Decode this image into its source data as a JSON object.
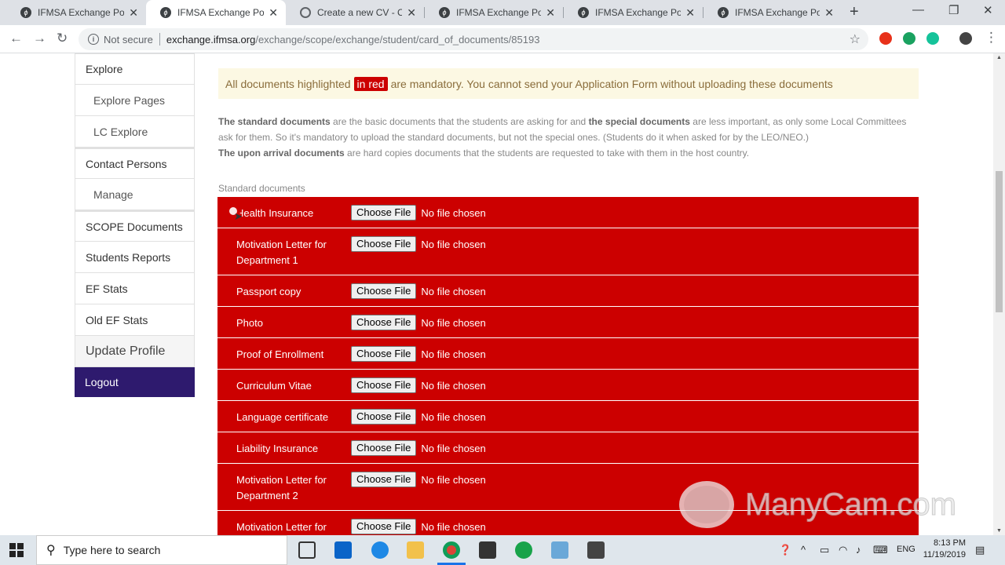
{
  "browser": {
    "tabs": [
      {
        "label": "IFMSA Exchange Portal",
        "active": false
      },
      {
        "label": "IFMSA Exchange Portal",
        "active": true
      },
      {
        "label": "Create a new CV - CV M",
        "active": false
      },
      {
        "label": "IFMSA Exchange Portal",
        "active": false
      },
      {
        "label": "IFMSA Exchange Portal",
        "active": false
      },
      {
        "label": "IFMSA Exchange Portal",
        "active": false
      }
    ],
    "not_secure": "Not secure",
    "url_domain": "exchange.ifmsa.org",
    "url_path": "/exchange/scope/exchange/student/card_of_documents/85193"
  },
  "sidebar": {
    "items": [
      {
        "label": "Explore"
      },
      {
        "label": "Explore Pages"
      },
      {
        "label": "LC Explore"
      },
      {
        "label": "Contact Persons"
      },
      {
        "label": "Manage"
      },
      {
        "label": "SCOPE Documents"
      },
      {
        "label": "Students Reports"
      },
      {
        "label": "EF Stats"
      },
      {
        "label": "Old EF Stats"
      },
      {
        "label": "Update Profile"
      },
      {
        "label": "Logout"
      }
    ]
  },
  "alert": {
    "before": "All documents highlighted",
    "highlight": "in red",
    "after": "are mandatory. You cannot send your Application Form without uploading these documents"
  },
  "description": {
    "p1_bold1": "The standard documents",
    "p1_text1": " are the basic documents that the students are asking for and ",
    "p1_bold2": "the special documents",
    "p1_text2": " are less important, as only some Local Committees ask for them. So it's mandatory to upload the standard documents, but not the special ones. (Students do it when asked for by the LEO/NEO.)",
    "p2_bold": "The upon arrival documents",
    "p2_text": " are hard copies documents that the students are requested to take with them in the host country."
  },
  "section_label": "Standard documents",
  "file_button_label": "Choose File",
  "no_file_text": "No file chosen",
  "documents": [
    {
      "name": "Health Insurance"
    },
    {
      "name": "Motivation Letter for Department 1"
    },
    {
      "name": "Passport copy"
    },
    {
      "name": "Photo"
    },
    {
      "name": "Proof of Enrollment"
    },
    {
      "name": "Curriculum Vitae"
    },
    {
      "name": "Language certificate"
    },
    {
      "name": "Liability Insurance"
    },
    {
      "name": "Motivation Letter for Department 2"
    },
    {
      "name": "Motivation Letter for"
    }
  ],
  "watermark": "ManyCam.com",
  "taskbar": {
    "search_placeholder": "Type here to search",
    "lang": "ENG",
    "time": "8:13 PM",
    "date": "11/19/2019"
  },
  "colors": {
    "mandatory_red": "#cc0000",
    "logout_bg": "#2e1a6e",
    "alert_bg": "#fcf8e3"
  }
}
